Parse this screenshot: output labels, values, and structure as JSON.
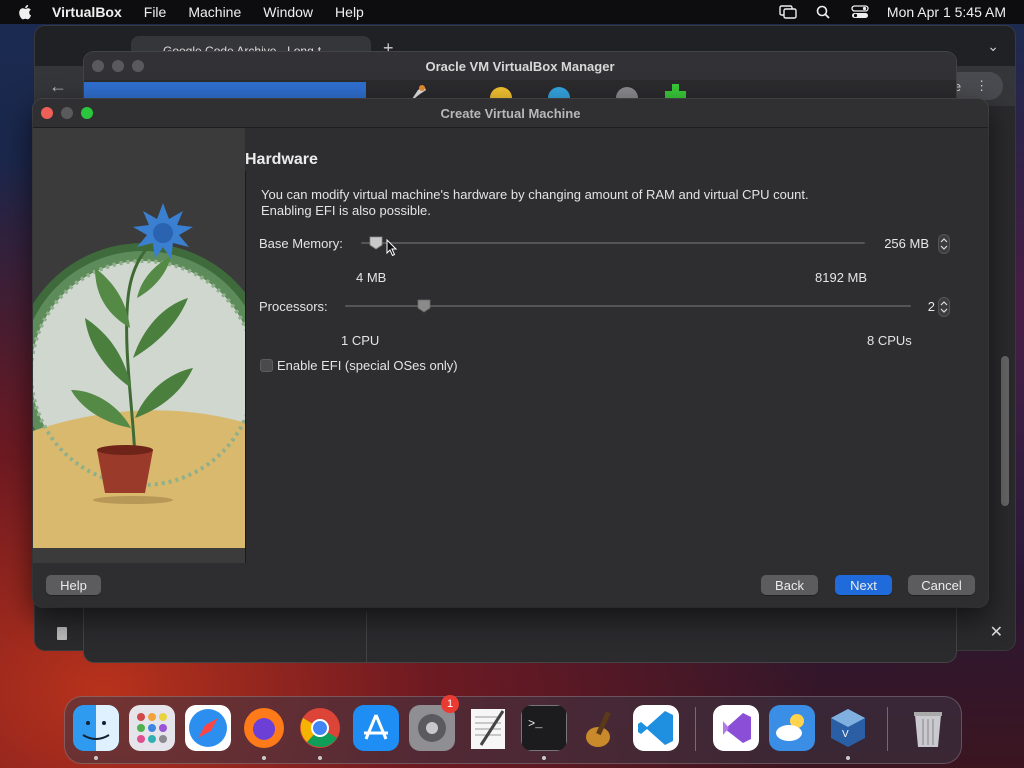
{
  "menubar": {
    "app_name": "VirtualBox",
    "items": [
      "File",
      "Machine",
      "Window",
      "Help"
    ],
    "clock": "Mon Apr 1  5:45 AM"
  },
  "browser": {
    "tab_title": "Google Code Archive - Long-t",
    "update_label": "ate"
  },
  "manager": {
    "title": "Oracle VM VirtualBox Manager"
  },
  "dialog": {
    "title": "Create Virtual Machine",
    "heading": "Hardware",
    "description_line1": "You can modify virtual machine's hardware by changing amount of RAM and virtual CPU count.",
    "description_line2": "Enabling EFI is also possible.",
    "memory": {
      "label": "Base Memory:",
      "value": "256 MB",
      "min_label": "4 MB",
      "max_label": "8192 MB",
      "level": 0.03
    },
    "processors": {
      "label": "Processors:",
      "value": "2",
      "min_label": "1 CPU",
      "max_label": "8 CPUs",
      "level": 0.14
    },
    "efi": {
      "label": "Enable EFI (special OSes only)",
      "checked": false
    },
    "buttons": {
      "help": "Help",
      "back": "Back",
      "next": "Next",
      "cancel": "Cancel"
    }
  },
  "dock": {
    "apps": [
      "finder-icon",
      "launchpad-icon",
      "safari-icon",
      "firefox-icon",
      "chrome-icon",
      "app-store-icon",
      "system-settings-icon",
      "textedit-icon",
      "terminal-icon",
      "garageband-icon",
      "vscode-icon",
      "visual-studio-icon",
      "weather-icon",
      "virtualbox-icon",
      "trash-icon"
    ],
    "settings_badge": "1"
  },
  "colors": {
    "accent": "#1f6bdc",
    "close": "#ee5f57",
    "zoom": "#2bc63e"
  }
}
